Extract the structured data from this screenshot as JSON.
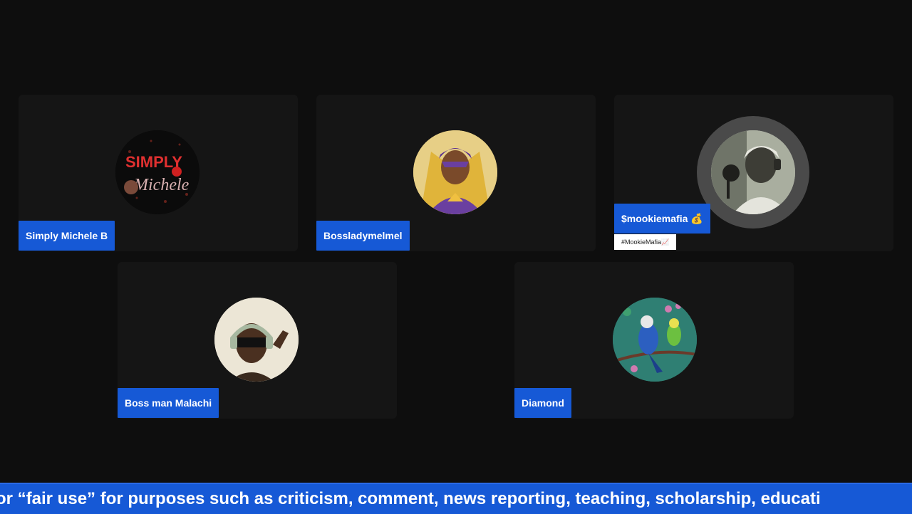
{
  "participants": [
    {
      "name": "Simply Michele B",
      "avatar": "simply-michele-logo"
    },
    {
      "name": "Bossladymelmel",
      "avatar": "superhero-woman-avatar"
    },
    {
      "name": "$mookiemafia 💰",
      "subtitle": "#MookieMafia📈",
      "avatar": "man-headphones-photo",
      "speaking": true
    },
    {
      "name": "Boss man Malachi",
      "avatar": "boy-sunglasses-photo"
    },
    {
      "name": "Diamond",
      "avatar": "parakeet-painting"
    }
  ],
  "avatar_text": {
    "simply_michele": "SIMPLY",
    "simply_michele_script": "Michele"
  },
  "ticker": {
    "text": "or “fair use” for purposes such as criticism, comment, news reporting, teaching, scholarship, educati"
  },
  "colors": {
    "accent": "#1659d6",
    "background": "#0e0e0e",
    "tile": "#151515"
  }
}
